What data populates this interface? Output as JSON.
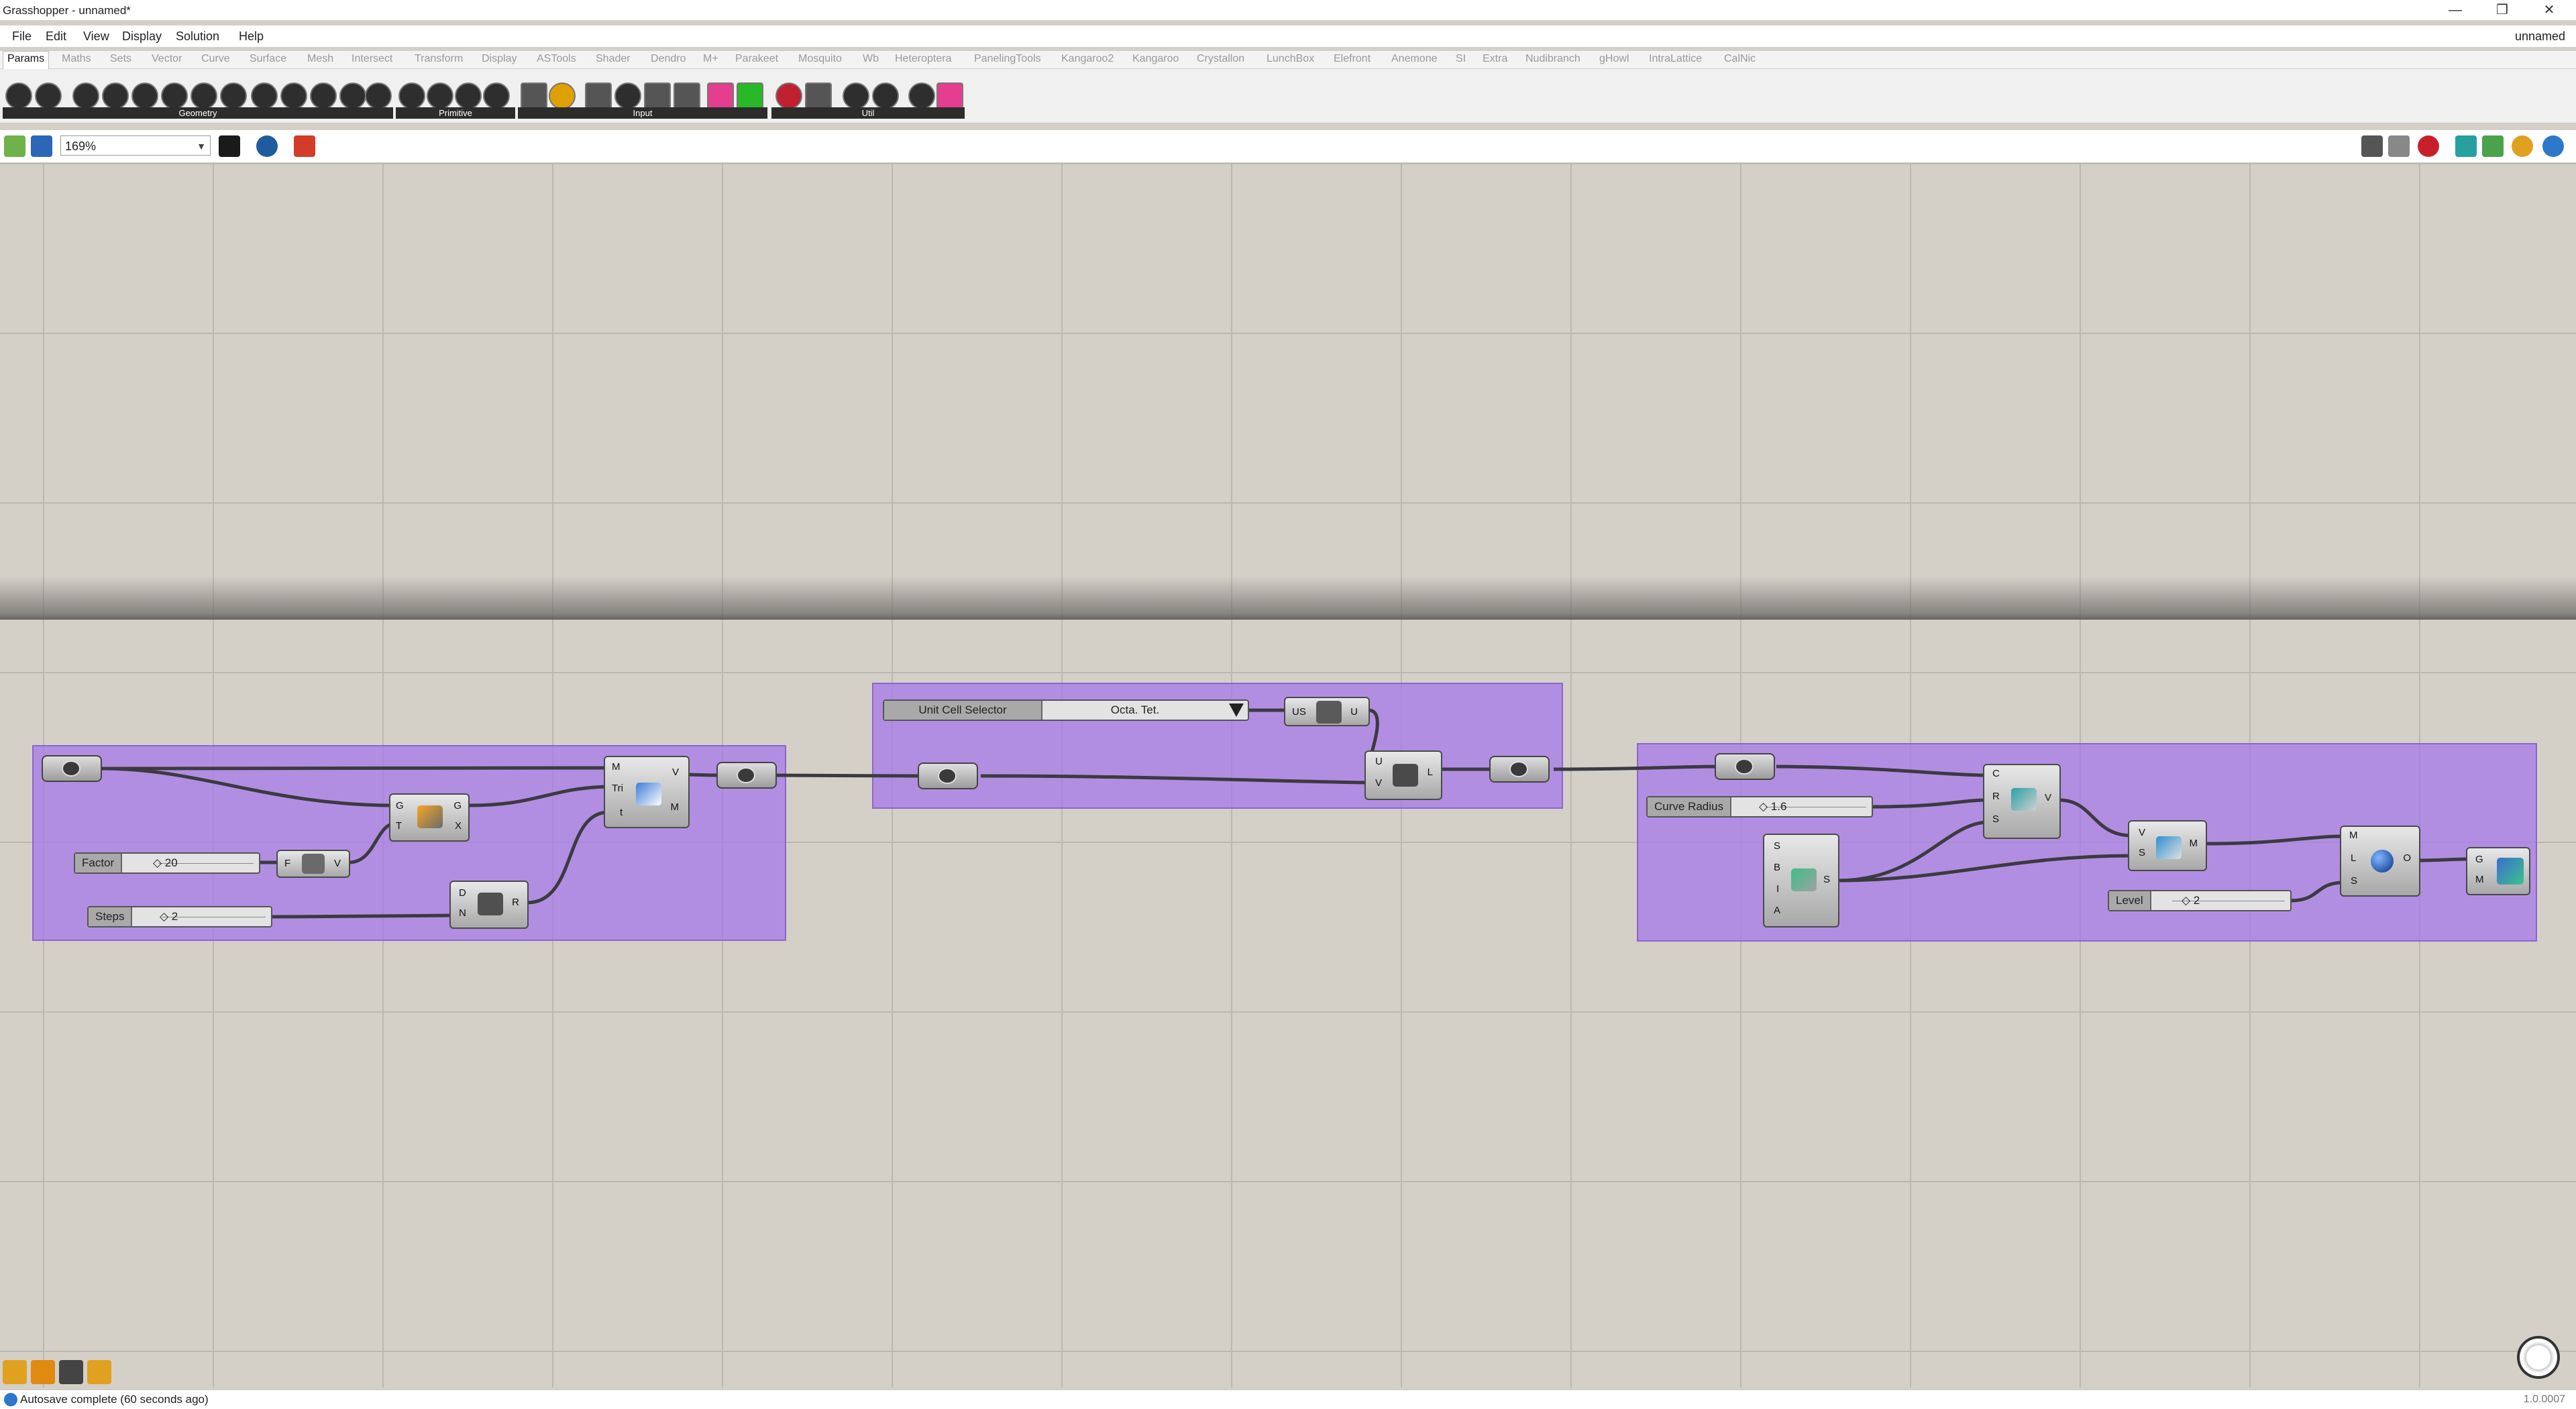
{
  "window": {
    "title": "Grasshopper - unnamed*",
    "minimize": "—",
    "restore": "❐",
    "close": "✕"
  },
  "menubar": {
    "items": [
      "File",
      "Edit",
      "View",
      "Display",
      "Solution",
      "Help"
    ],
    "document": "unnamed"
  },
  "tabs": [
    "Params",
    "Maths",
    "Sets",
    "Vector",
    "Curve",
    "Surface",
    "Mesh",
    "Intersect",
    "Transform",
    "Display",
    "ASTools",
    "Shader",
    "Dendro",
    "M+",
    "Parakeet",
    "Mosquito",
    "Wb",
    "Heteroptera",
    "PanelingTools",
    "Kangaroo2",
    "Kangaroo",
    "Crystallon",
    "LunchBox",
    "Elefront",
    "Anemone",
    "SI",
    "Extra",
    "Nudibranch",
    "gHowl",
    "IntraLattice",
    "CalNic"
  ],
  "ribbon_groups": [
    "Geometry",
    "Primitive",
    "Input",
    "Util"
  ],
  "toolbar": {
    "zoom": "169%"
  },
  "canvas": {
    "components": {
      "mesh_tri": {
        "in": [
          "M",
          "Tri",
          "t"
        ],
        "out": [
          "V",
          "M"
        ]
      },
      "gradient": {
        "in": [
          "G",
          "T"
        ],
        "out": [
          "G",
          "X"
        ]
      },
      "expression": {
        "in": [
          "F"
        ],
        "out": [
          "V"
        ]
      },
      "distance": {
        "in": [
          "D",
          "N"
        ],
        "out": [
          "R"
        ]
      },
      "crystallon": {
        "in": [
          "U",
          "V"
        ],
        "out": [
          "L"
        ]
      },
      "us": {
        "in": [
          "US"
        ],
        "out": [
          "U"
        ]
      },
      "pipe": {
        "in": [
          "C",
          "R",
          "S"
        ],
        "out": [
          "V"
        ]
      },
      "box": {
        "in": [
          "S",
          "B",
          "I",
          "A"
        ],
        "out": [
          "S"
        ]
      },
      "voxel": {
        "in": [
          "V",
          "S"
        ],
        "out": [
          "M"
        ]
      },
      "smooth": {
        "in": [
          "M",
          "L",
          "S"
        ],
        "out": [
          "O"
        ]
      },
      "preview": {
        "in": [
          "G",
          "M"
        ]
      }
    },
    "sliders": {
      "factor": {
        "label": "Factor",
        "value": "◇ 20"
      },
      "steps": {
        "label": "Steps",
        "value": "◇ 2"
      },
      "curve_radius": {
        "label": "Curve Radius",
        "value": "◇ 1.6"
      },
      "level": {
        "label": "Level",
        "value": "◇ 2"
      }
    },
    "value_list": {
      "label": "Unit Cell Selector",
      "value": "Octa. Tet."
    }
  },
  "status": {
    "message": "Autosave complete (60 seconds ago)",
    "version": "1.0.0007"
  },
  "colors": {
    "group": "#a57beb",
    "canvas": "#d4d0c8",
    "wire": "#3c3a40"
  }
}
